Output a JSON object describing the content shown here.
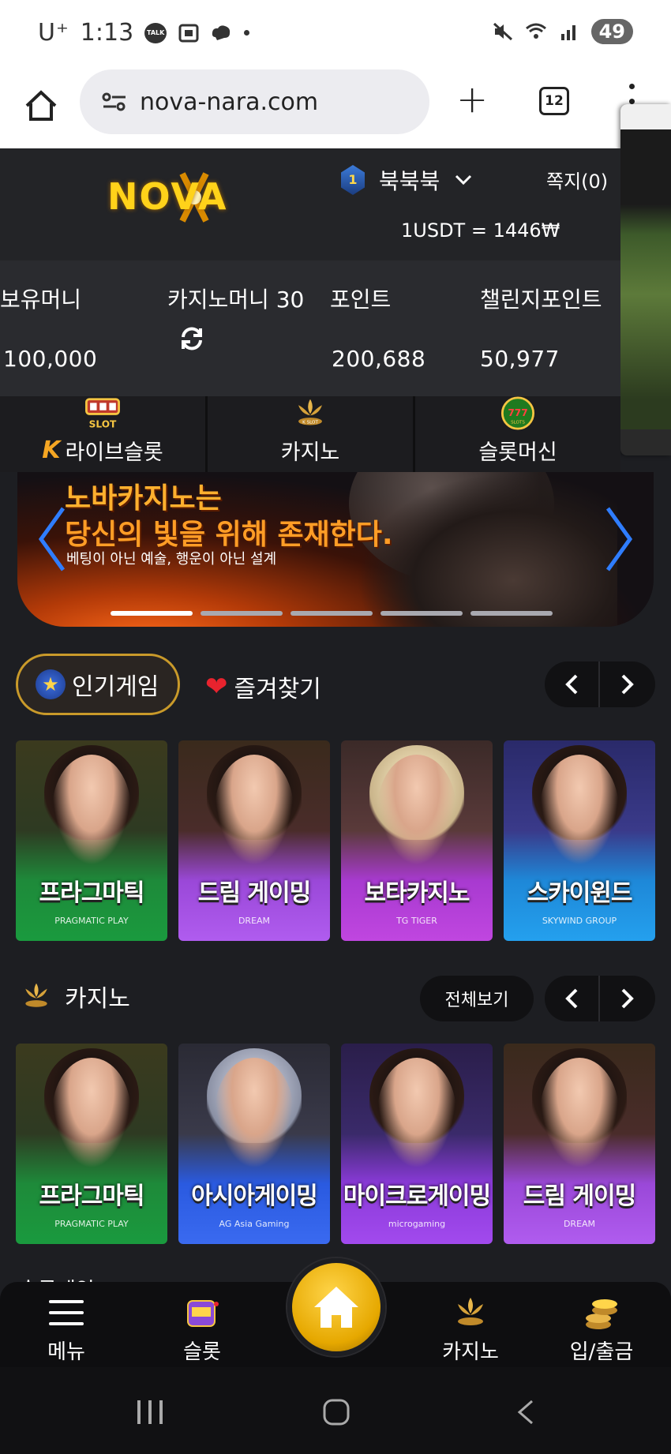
{
  "status_bar": {
    "carrier": "U⁺",
    "time": "1:13",
    "talk_badge": "TALK",
    "battery": "49"
  },
  "browser": {
    "url": "nova-nara.com",
    "tab_count": "12"
  },
  "header": {
    "logo_text": "NOVA",
    "level": "1",
    "username": "북북북",
    "messages": "쪽지(0)",
    "exchange_rate": "1USDT = 1446₩"
  },
  "balances": {
    "holding_label": "보유머니",
    "holding_value": "100,000",
    "casino_label": "카지노머니 30",
    "point_label": "포인트",
    "point_value": "200,688",
    "challenge_label": "챌린지포인트",
    "challenge_value": "50,977"
  },
  "categories": [
    {
      "label": "라이브슬롯",
      "icon": "live-slot-icon"
    },
    {
      "label": "카지노",
      "icon": "k-slot-crown-icon"
    },
    {
      "label": "슬롯머신",
      "icon": "777-slots-icon"
    }
  ],
  "banner": {
    "title_line1": "노바카지노는",
    "title_line2": "당신의 빛을 위해 존재한다.",
    "subtitle": "베팅이 아닌 예술, 행운이 아닌 설계",
    "slide_count": 5,
    "active_slide": 1
  },
  "popular_section": {
    "active_tab": "인기게임",
    "fav_tab": "즐겨찾기"
  },
  "popular_games": [
    {
      "name": "프라그마틱",
      "brand": "PRAGMATIC PLAY",
      "theme": "green"
    },
    {
      "name": "드림 게이밍",
      "brand": "DREAM",
      "theme": "purple"
    },
    {
      "name": "보타카지노",
      "brand": "TG TIGER",
      "theme": "magenta"
    },
    {
      "name": "스카이윈드",
      "brand": "SKYWIND GROUP",
      "theme": "blue"
    }
  ],
  "casino_section": {
    "title": "카지노",
    "view_all": "전체보기"
  },
  "casino_games": [
    {
      "name": "프라그마틱",
      "brand": "PRAGMATIC PLAY",
      "theme": "green"
    },
    {
      "name": "아시아게이밍",
      "brand": "AG Asia Gaming",
      "theme": "blue"
    },
    {
      "name": "마이크로게이밍",
      "brand": "microgaming",
      "theme": "purple"
    },
    {
      "name": "드림 게이밍",
      "brand": "DREAM",
      "theme": "purple"
    }
  ],
  "next_section_peek": "슬롯게임",
  "bottom_nav": {
    "menu": "메뉴",
    "slot": "슬롯",
    "casino": "카지노",
    "deposit": "입/출금"
  },
  "colors": {
    "gold": "#ffd21a",
    "accent_border": "#c99a2a",
    "heart": "#e8232e",
    "background": "#1d1e22"
  }
}
